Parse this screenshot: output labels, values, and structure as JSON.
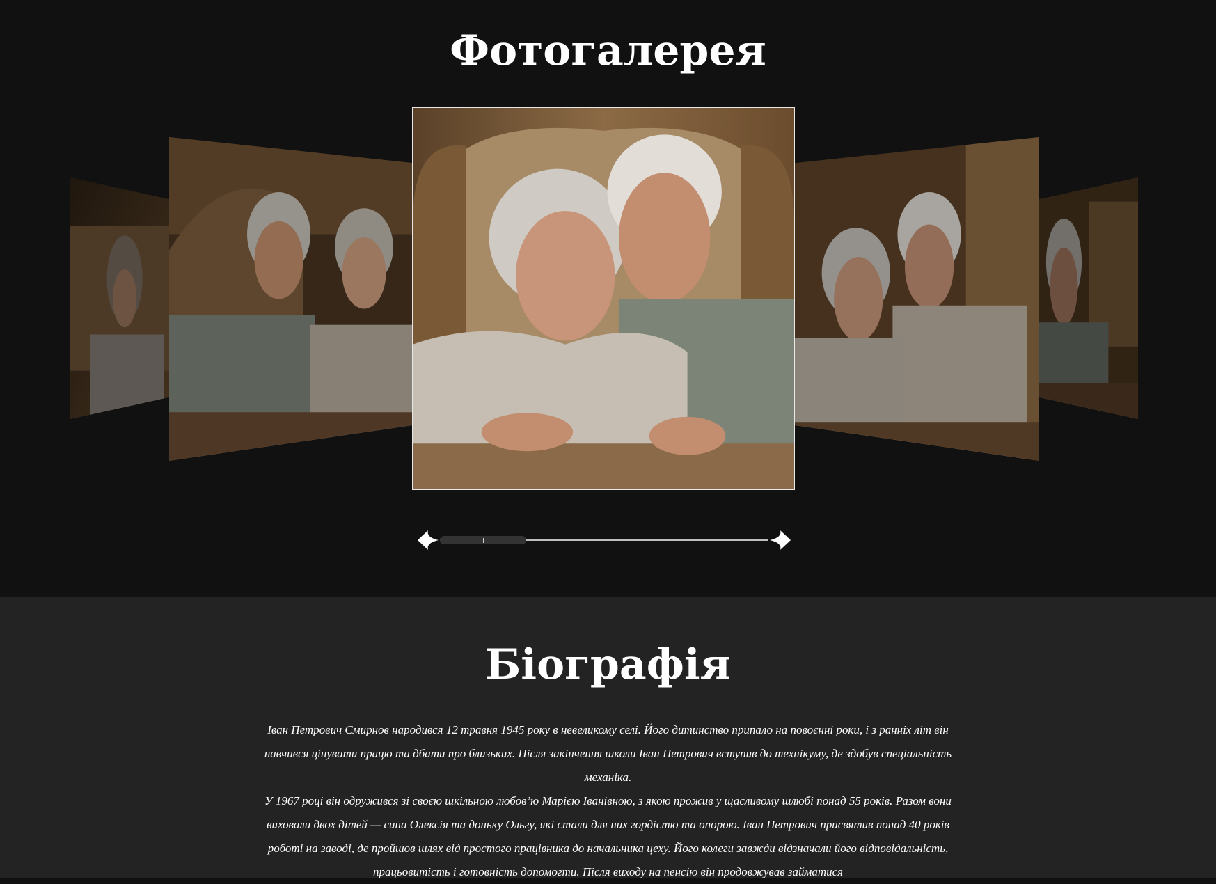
{
  "gallery": {
    "title": "Фотогалерея",
    "slides": [
      {
        "position": "far-left",
        "alt": "photo-couple"
      },
      {
        "position": "left",
        "alt": "photo-couple"
      },
      {
        "position": "center",
        "alt": "photo-couple"
      },
      {
        "position": "right",
        "alt": "photo-couple"
      },
      {
        "position": "far-right",
        "alt": "photo-couple"
      }
    ],
    "scroll_progress": 0.0,
    "prev_icon": "arrow-left-icon",
    "next_icon": "arrow-right-icon"
  },
  "biography": {
    "title": "Біографія",
    "paragraph_1": "Іван Петрович Смирнов народився 12 травня 1945 року в невеликому селі. Його дитинство припало на повоєнні роки, і з ранніх літ він навчився цінувати працю та дбати про близьких. Після закінчення школи Іван Петрович вступив до технікуму, де здобув спеціальність механіка.",
    "paragraph_2": "У 1967 році він одружився зі своєю шкільною любов’ю Марією Іванівною, з якою прожив у щасливому шлюбі понад 55 років. Разом вони виховали двох дітей — сина Олексія та доньку Ольгу, які стали для них гордістю та опорою. Іван Петрович присвятив понад 40 років роботі на заводі, де пройшов шлях від простого працівника до начальника цеху. Його колеги завжди відзначали його відповідальність, працьовитість і готовність допомогти. Після виходу на пенсію він продовжував займатися"
  },
  "colors": {
    "gallery_bg": "#111111",
    "bio_bg": "#232323",
    "text": "#ffffff"
  }
}
